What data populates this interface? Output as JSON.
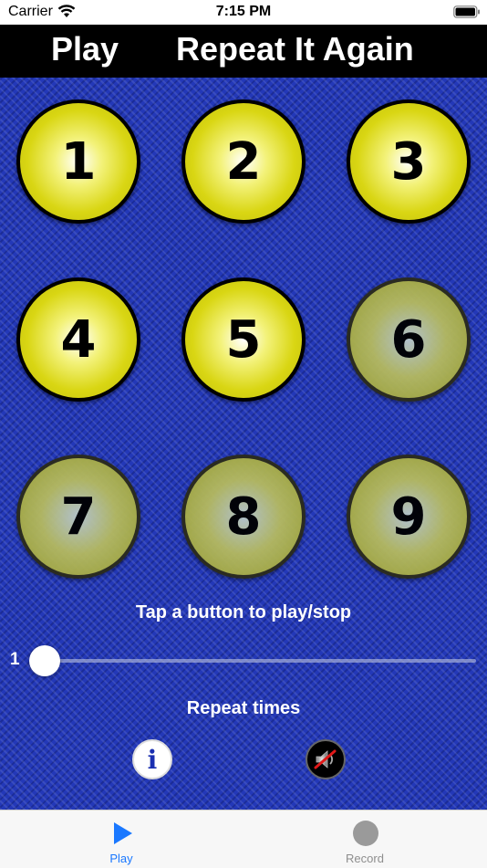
{
  "status_bar": {
    "carrier": "Carrier",
    "time": "7:15 PM"
  },
  "header": {
    "left_title": "Play",
    "right_title": "Repeat It Again"
  },
  "buttons": [
    {
      "label": "1",
      "state": "lit"
    },
    {
      "label": "2",
      "state": "lit"
    },
    {
      "label": "3",
      "state": "lit"
    },
    {
      "label": "4",
      "state": "lit"
    },
    {
      "label": "5",
      "state": "lit"
    },
    {
      "label": "6",
      "state": "dim"
    },
    {
      "label": "7",
      "state": "dim"
    },
    {
      "label": "8",
      "state": "dim"
    },
    {
      "label": "9",
      "state": "dim"
    }
  ],
  "hint": "Tap a button to play/stop",
  "slider": {
    "value_label": "1",
    "value": 1
  },
  "repeat_label": "Repeat times",
  "controls": {
    "info_icon": "info-icon",
    "sound_icon": "speaker-muted-icon"
  },
  "tabs": [
    {
      "label": "Play",
      "icon": "play-icon",
      "active": true
    },
    {
      "label": "Record",
      "icon": "record-icon",
      "active": false
    }
  ],
  "colors": {
    "accent": "#1a78ff",
    "background": "#2338b8",
    "button_yellow": "#d9d613"
  }
}
